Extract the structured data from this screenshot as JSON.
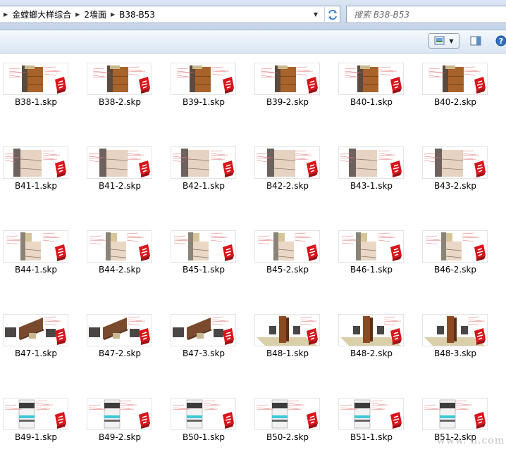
{
  "address": {
    "breadcrumbs": [
      {
        "label": "金螳螂大样综合"
      },
      {
        "label": "2墙面"
      },
      {
        "label": "B38-B53"
      }
    ]
  },
  "search": {
    "placeholder": "搜索 B38-B53"
  },
  "toolbar": {
    "icons": [
      "view-mode-icon",
      "preview-pane-icon",
      "help-icon"
    ],
    "help_label": "?"
  },
  "files": [
    {
      "name": "B38-1.skp",
      "style": "wood"
    },
    {
      "name": "B38-2.skp",
      "style": "wood"
    },
    {
      "name": "B39-1.skp",
      "style": "wood"
    },
    {
      "name": "B39-2.skp",
      "style": "wood"
    },
    {
      "name": "B40-1.skp",
      "style": "wood"
    },
    {
      "name": "B40-2.skp",
      "style": "wood"
    },
    {
      "name": "B41-1.skp",
      "style": "stone"
    },
    {
      "name": "B41-2.skp",
      "style": "stone"
    },
    {
      "name": "B42-1.skp",
      "style": "stone"
    },
    {
      "name": "B42-2.skp",
      "style": "stone"
    },
    {
      "name": "B43-1.skp",
      "style": "stone"
    },
    {
      "name": "B43-2.skp",
      "style": "stone"
    },
    {
      "name": "B44-1.skp",
      "style": "panel"
    },
    {
      "name": "B44-2.skp",
      "style": "panel"
    },
    {
      "name": "B45-1.skp",
      "style": "panel"
    },
    {
      "name": "B45-2.skp",
      "style": "panel"
    },
    {
      "name": "B46-1.skp",
      "style": "panel"
    },
    {
      "name": "B46-2.skp",
      "style": "panel"
    },
    {
      "name": "B47-1.skp",
      "style": "fold"
    },
    {
      "name": "B47-2.skp",
      "style": "fold"
    },
    {
      "name": "B47-3.skp",
      "style": "fold"
    },
    {
      "name": "B48-1.skp",
      "style": "post"
    },
    {
      "name": "B48-2.skp",
      "style": "post"
    },
    {
      "name": "B48-3.skp",
      "style": "post"
    },
    {
      "name": "B49-1.skp",
      "style": "glass"
    },
    {
      "name": "B49-2.skp",
      "style": "glass"
    },
    {
      "name": "B50-1.skp",
      "style": "glass"
    },
    {
      "name": "B50-2.skp",
      "style": "glass"
    },
    {
      "name": "B51-1.skp",
      "style": "glass"
    },
    {
      "name": "B51-2.skp",
      "style": "glass"
    }
  ],
  "watermark": "www.    n.com",
  "colors": {
    "sketchup_red": "#d9141b",
    "address_bar": "#cfdcec",
    "toolbar": "#e7eff8"
  }
}
